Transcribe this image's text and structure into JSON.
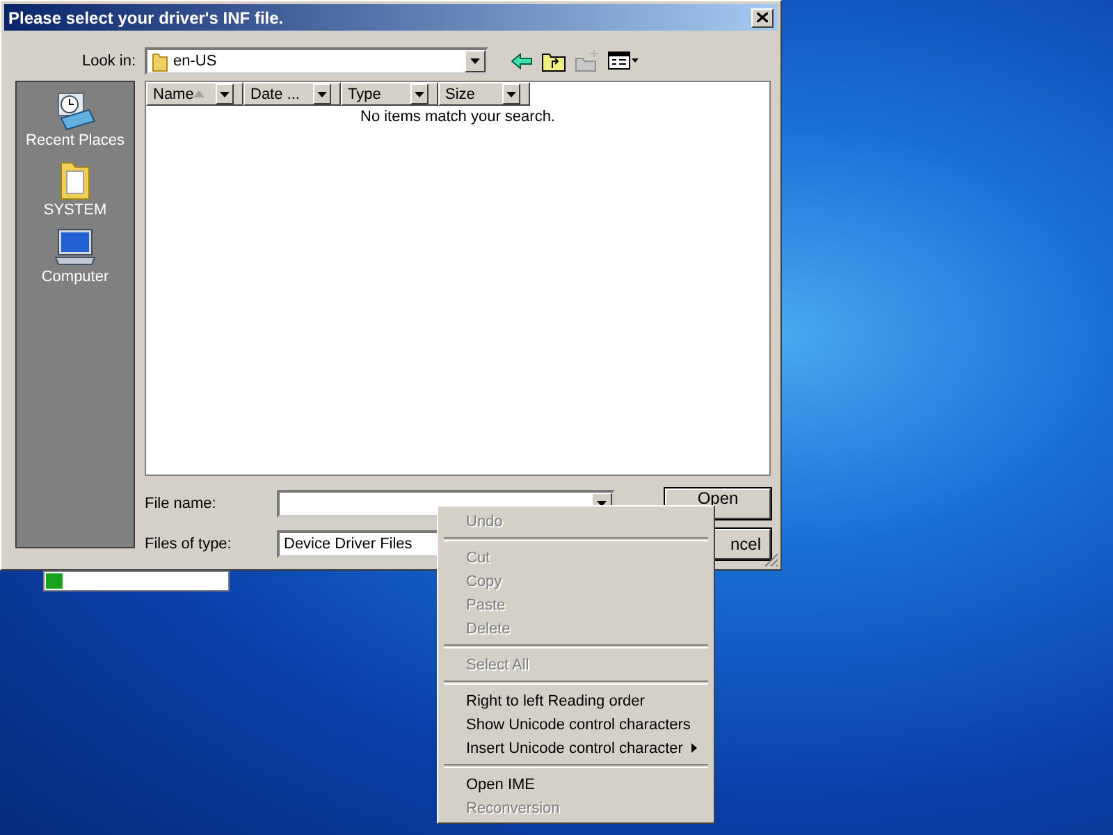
{
  "dialog": {
    "title": "Please select your driver's INF file.",
    "look_in": {
      "label": "Look in:",
      "value": "en-US"
    },
    "places": [
      {
        "label": "Recent Places",
        "kind": "recent"
      },
      {
        "label": "SYSTEM",
        "kind": "folder"
      },
      {
        "label": "Computer",
        "kind": "computer"
      }
    ],
    "columns": [
      {
        "label": "Name",
        "sorted": true
      },
      {
        "label": "Date ...",
        "sorted": false
      },
      {
        "label": "Type",
        "sorted": false
      },
      {
        "label": "Size",
        "sorted": false
      }
    ],
    "empty_message": "No items match your search.",
    "file_name": {
      "label": "File name:"
    },
    "file_type": {
      "label": "Files of type:",
      "value": "Device Driver Files"
    },
    "buttons": [
      "Open",
      "ncel"
    ]
  },
  "progress": {
    "level": 0.09
  },
  "context_menu": [
    {
      "label": "Undo",
      "disabled": true,
      "submenu": false
    },
    {
      "kind": "separator"
    },
    {
      "label": "Cut",
      "disabled": true,
      "submenu": false
    },
    {
      "label": "Copy",
      "disabled": true,
      "submenu": false
    },
    {
      "label": "Paste",
      "disabled": true,
      "submenu": false
    },
    {
      "label": "Delete",
      "disabled": true,
      "submenu": false
    },
    {
      "kind": "separator"
    },
    {
      "label": "Select All",
      "disabled": true,
      "submenu": false
    },
    {
      "kind": "separator"
    },
    {
      "label": "Right to left Reading order",
      "disabled": false,
      "submenu": false
    },
    {
      "label": "Show Unicode control characters",
      "disabled": false,
      "submenu": false
    },
    {
      "label": "Insert Unicode control character",
      "disabled": false,
      "submenu": true
    },
    {
      "kind": "separator"
    },
    {
      "label": "Open IME",
      "disabled": false,
      "submenu": false
    },
    {
      "label": "Reconversion",
      "disabled": true,
      "submenu": false
    }
  ]
}
